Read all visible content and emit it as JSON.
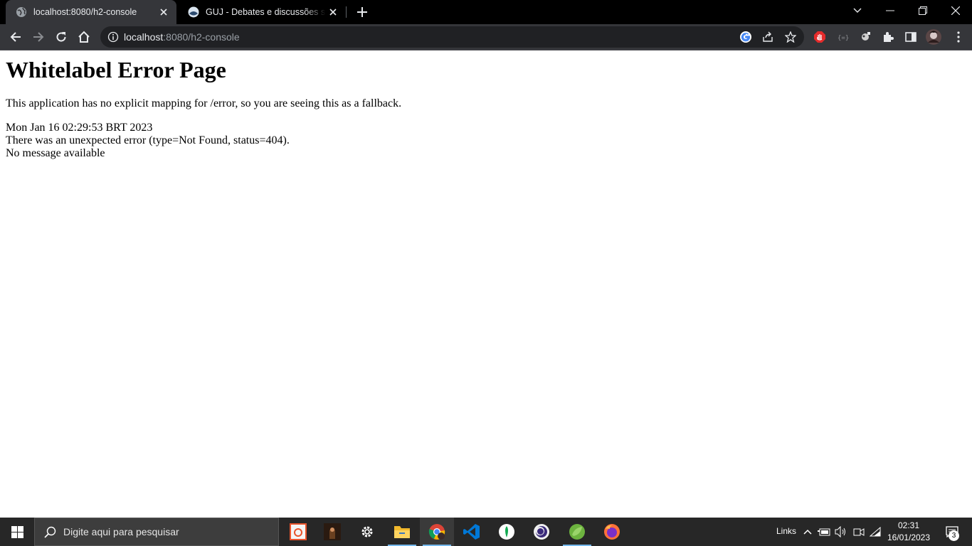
{
  "browser": {
    "tabs": [
      {
        "title": "localhost:8080/h2-console",
        "active": true,
        "icon": "globe-icon"
      },
      {
        "title": "GUJ - Debates e discussões sobre",
        "active": false,
        "icon": "guj-icon"
      }
    ],
    "omnibox": {
      "host": "localhost",
      "path": ":8080/h2-console"
    }
  },
  "page": {
    "heading": "Whitelabel Error Page",
    "description": "This application has no explicit mapping for /error, so you are seeing this as a fallback.",
    "timestamp": "Mon Jan 16 02:29:53 BRT 2023",
    "error_line": "There was an unexpected error (type=Not Found, status=404).",
    "message": "No message available"
  },
  "taskbar": {
    "search_placeholder": "Digite aqui para pesquisar",
    "links_label": "Links",
    "time": "02:31",
    "date": "16/01/2023",
    "notification_count": "3"
  },
  "colors": {
    "tab_active_bg": "#35363a",
    "omnibox_bg": "#202124",
    "taskbar_bg": "#272727",
    "accent": "#76b9ed"
  }
}
